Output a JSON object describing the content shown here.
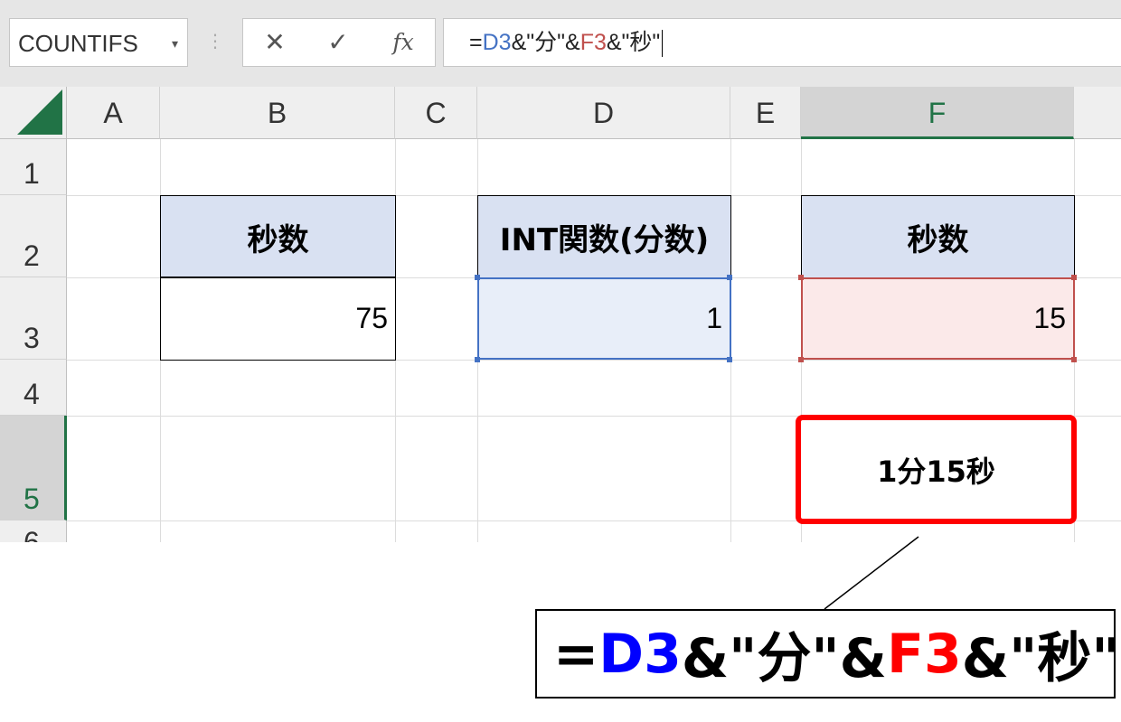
{
  "formula_bar": {
    "name_box": "COUNTIFS",
    "menu_dots": "⋮",
    "cancel_icon": "✕",
    "enter_icon": "✓",
    "fx_label": "fx",
    "formula_prefix": "=",
    "formula_ref1": "D3",
    "formula_mid": "&\"分\"&",
    "formula_ref2": "F3",
    "formula_suffix": "&\"秒\""
  },
  "columns": [
    "A",
    "B",
    "C",
    "D",
    "E",
    "F"
  ],
  "rows": [
    "1",
    "2",
    "3",
    "4",
    "5",
    "6"
  ],
  "cells": {
    "B2": "秒数",
    "D2": "INT関数(分数)",
    "F2": "秒数",
    "B3": "75",
    "D3": "1",
    "F3": "15",
    "F5": "1分15秒"
  },
  "callout": {
    "prefix": "=",
    "ref1": "D3",
    "mid": "&\"分\"&",
    "ref2": "F3",
    "suffix": "&\"秒\""
  },
  "colors": {
    "excel_green": "#217346",
    "header_fill": "#d9e1f2",
    "ref1_color": "#0000ff",
    "ref2_color": "#ff0000",
    "highlight_border": "#ff0000"
  }
}
